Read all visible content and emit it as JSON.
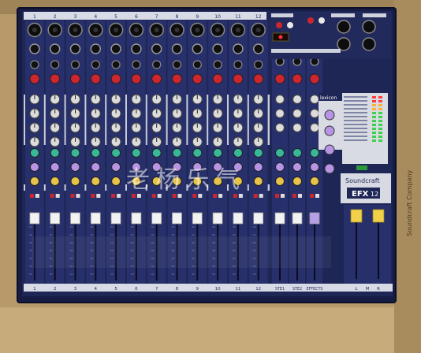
{
  "top_numbers": [
    "1",
    "2",
    "3",
    "4",
    "5",
    "6",
    "7",
    "8",
    "9",
    "10",
    "11",
    "12"
  ],
  "bottom_numbers": [
    "1",
    "2",
    "3",
    "4",
    "5",
    "6",
    "7",
    "8",
    "9",
    "10",
    "11",
    "12"
  ],
  "stereo_channels": [
    "STE1",
    "STE2",
    "EFFECTS"
  ],
  "brand": "Soundcraft",
  "model": "EFX",
  "model_suffix": "12",
  "lexicon": "lexicon",
  "master_labels": [
    "L",
    "M",
    "R"
  ],
  "box_side_text": "Soundcraft Company",
  "watermark": "老杨乐气",
  "colors": {
    "box": "#b89a6a",
    "panel": "#1e2656",
    "strip": "#27306a",
    "knob_red": "#cc2630",
    "knob_green": "#37b898",
    "knob_yellow": "#e6c24a",
    "knob_violet": "#b794e6",
    "knob_blue": "#3c66d2",
    "fader_white": "#f2f2f2",
    "fader_yellow": "#f2d14a"
  }
}
